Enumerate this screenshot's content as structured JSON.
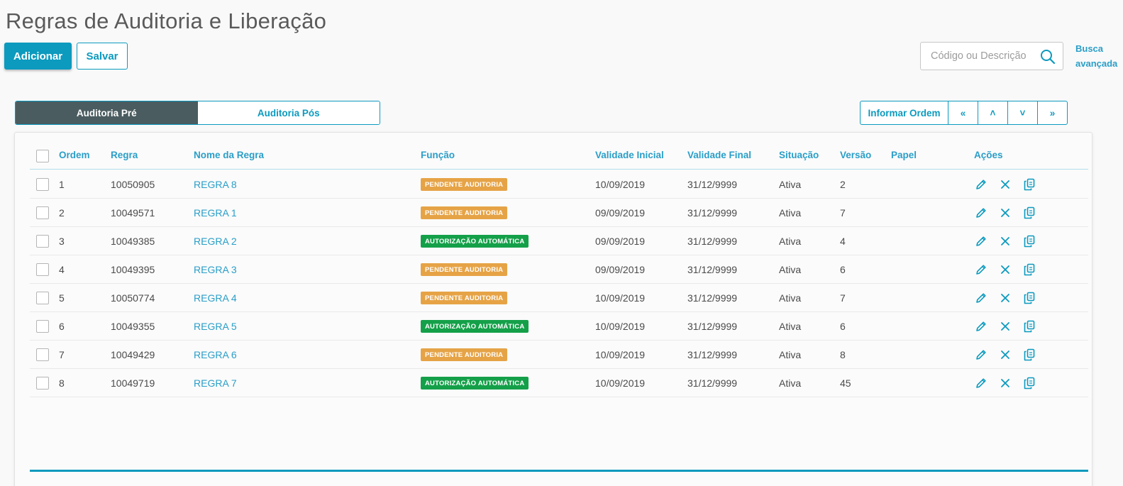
{
  "page": {
    "title": "Regras de Auditoria e Liberação"
  },
  "toolbar": {
    "add_label": "Adicionar",
    "save_label": "Salvar"
  },
  "search": {
    "placeholder": "Código ou Descrição",
    "value": "",
    "advanced_line1": "Busca",
    "advanced_line2": "avançada"
  },
  "tabs": [
    {
      "label": "Auditoria Pré",
      "active": true
    },
    {
      "label": "Auditoria Pós",
      "active": false
    }
  ],
  "order_controls": {
    "inform_label": "Informar Ordem",
    "first": "«",
    "up": "˄",
    "down": "˅",
    "last": "»"
  },
  "table": {
    "headers": {
      "ordem": "Ordem",
      "regra": "Regra",
      "nome": "Nome da Regra",
      "funcao": "Função",
      "validade_inicial": "Validade Inicial",
      "validade_final": "Validade Final",
      "situacao": "Situação",
      "versao": "Versão",
      "papel": "Papel",
      "acoes": "Ações"
    },
    "rows": [
      {
        "ordem": "1",
        "regra": "10050905",
        "nome": "REGRA 8",
        "funcao": "PENDENTE AUDITORIA",
        "funcao_type": "pending",
        "validade_inicial": "10/09/2019",
        "validade_final": "31/12/9999",
        "situacao": "Ativa",
        "versao": "2",
        "papel": ""
      },
      {
        "ordem": "2",
        "regra": "10049571",
        "nome": "REGRA 1",
        "funcao": "PENDENTE AUDITORIA",
        "funcao_type": "pending",
        "validade_inicial": "09/09/2019",
        "validade_final": "31/12/9999",
        "situacao": "Ativa",
        "versao": "7",
        "papel": ""
      },
      {
        "ordem": "3",
        "regra": "10049385",
        "nome": "REGRA 2",
        "funcao": "AUTORIZAÇÃO AUTOMÁTICA",
        "funcao_type": "auto",
        "validade_inicial": "09/09/2019",
        "validade_final": "31/12/9999",
        "situacao": "Ativa",
        "versao": "4",
        "papel": ""
      },
      {
        "ordem": "4",
        "regra": "10049395",
        "nome": "REGRA 3",
        "funcao": "PENDENTE AUDITORIA",
        "funcao_type": "pending",
        "validade_inicial": "09/09/2019",
        "validade_final": "31/12/9999",
        "situacao": "Ativa",
        "versao": "6",
        "papel": ""
      },
      {
        "ordem": "5",
        "regra": "10050774",
        "nome": "REGRA 4",
        "funcao": "PENDENTE AUDITORIA",
        "funcao_type": "pending",
        "validade_inicial": "10/09/2019",
        "validade_final": "31/12/9999",
        "situacao": "Ativa",
        "versao": "7",
        "papel": ""
      },
      {
        "ordem": "6",
        "regra": "10049355",
        "nome": "REGRA 5",
        "funcao": "AUTORIZAÇÃO AUTOMÁTICA",
        "funcao_type": "auto",
        "validade_inicial": "10/09/2019",
        "validade_final": "31/12/9999",
        "situacao": "Ativa",
        "versao": "6",
        "papel": ""
      },
      {
        "ordem": "7",
        "regra": "10049429",
        "nome": "REGRA 6",
        "funcao": "PENDENTE AUDITORIA",
        "funcao_type": "pending",
        "validade_inicial": "10/09/2019",
        "validade_final": "31/12/9999",
        "situacao": "Ativa",
        "versao": "8",
        "papel": ""
      },
      {
        "ordem": "8",
        "regra": "10049719",
        "nome": "REGRA 7",
        "funcao": "AUTORIZAÇÃO AUTOMÁTICA",
        "funcao_type": "auto",
        "validade_inicial": "10/09/2019",
        "validade_final": "31/12/9999",
        "situacao": "Ativa",
        "versao": "45",
        "papel": ""
      }
    ],
    "row_actions": [
      "edit-icon",
      "delete-icon",
      "copy-icon"
    ]
  },
  "colors": {
    "accent": "#0c9abe",
    "link": "#2a9ec8",
    "tab_active": "#4a5c60",
    "badge_pending": "#e6a346",
    "badge_auto": "#14a049"
  }
}
